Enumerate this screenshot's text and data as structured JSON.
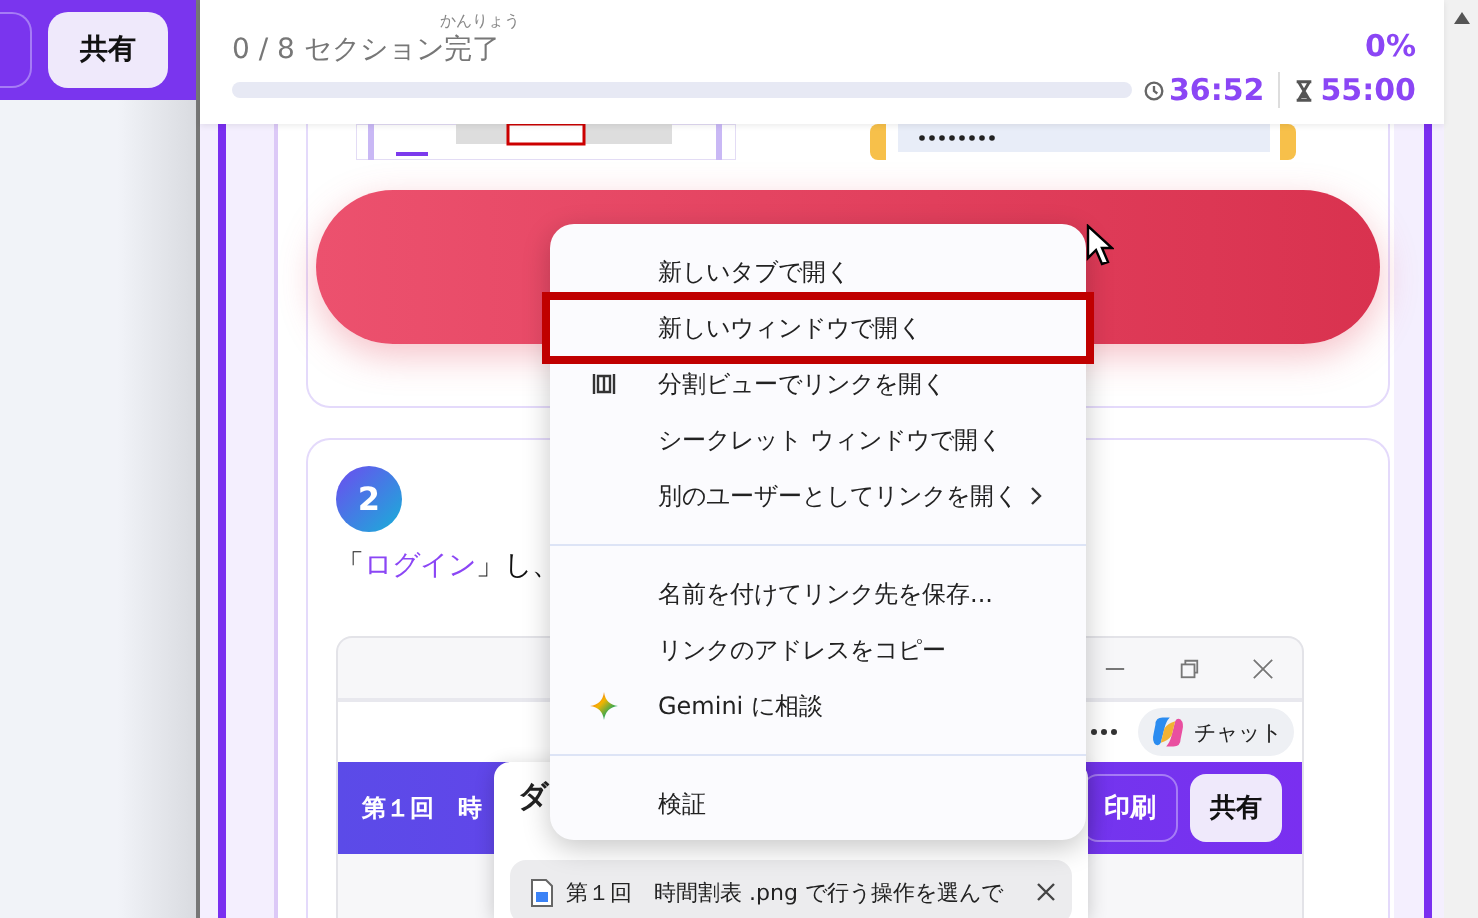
{
  "left_toolbar": {
    "buttons": [
      {
        "kind": "outline"
      },
      {
        "kind": "filled",
        "label": "共有"
      }
    ]
  },
  "header": {
    "progress_label": "0 / 8 セクション",
    "progress_ruby": {
      "base": "完了",
      "reading": "かんりょう"
    },
    "percent": "0%",
    "level": 0,
    "elapsed": "36:52",
    "limit": "55:00"
  },
  "step": {
    "number": "2",
    "instruction": [
      {
        "kind": "plain",
        "text": "「"
      },
      {
        "kind": "link",
        "text": "ログイン"
      },
      {
        "kind": "plain",
        "text": "」し、"
      }
    ]
  },
  "embedded_screenshot": {
    "chat_label": "チャット",
    "app_title": "第１回　時",
    "buttons": [
      {
        "kind": "outline",
        "label": "印刷"
      },
      {
        "kind": "filled",
        "label": "共有"
      }
    ],
    "download_panel": {
      "title": "ダ",
      "items": [
        {
          "filename": "第１回　時間割表 .png で行う操作を選んで"
        }
      ]
    }
  },
  "context_menu": {
    "items": [
      {
        "kind": "item",
        "label": "新しいタブで開く",
        "highlighted": false
      },
      {
        "kind": "item",
        "label": "新しいウィンドウで開く",
        "highlighted": true
      },
      {
        "kind": "split",
        "label": "分割ビューでリンクを開く",
        "highlighted": false
      },
      {
        "kind": "item",
        "label": "シークレット ウィンドウで開く",
        "highlighted": false
      },
      {
        "kind": "item",
        "label": "別のユーザーとしてリンクを開く",
        "submenu": true,
        "highlighted": false
      },
      {
        "kind": "separator"
      },
      {
        "kind": "item",
        "label": "名前を付けてリンク先を保存...",
        "highlighted": false
      },
      {
        "kind": "item",
        "label": "リンクのアドレスをコピー",
        "highlighted": false
      },
      {
        "kind": "sparkle",
        "label": "Gemini に相談",
        "highlighted": false
      },
      {
        "kind": "separator"
      },
      {
        "kind": "item",
        "label": "検証",
        "highlighted": false
      }
    ]
  }
}
